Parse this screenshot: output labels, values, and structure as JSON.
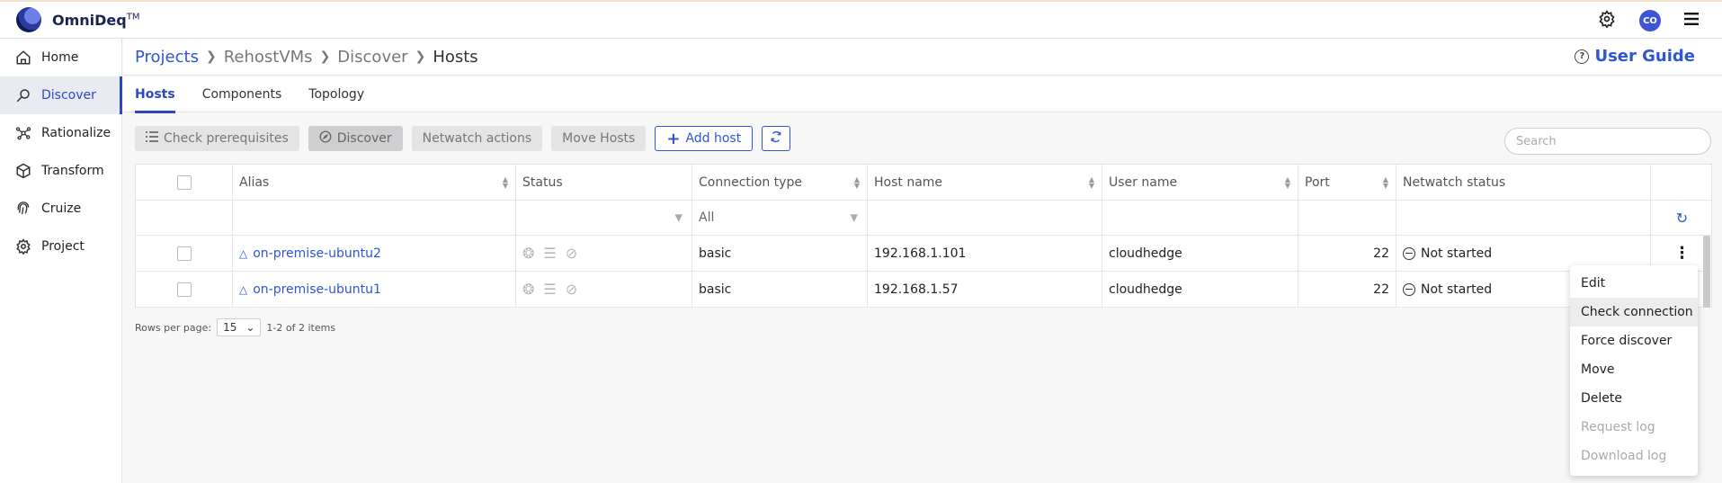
{
  "app": {
    "name": "OmniDeq",
    "tm": "TM",
    "avatar_initials": "CO"
  },
  "sidebar": {
    "items": [
      {
        "label": "Home",
        "icon": "home-icon",
        "active": false
      },
      {
        "label": "Discover",
        "icon": "discover-icon",
        "active": true
      },
      {
        "label": "Rationalize",
        "icon": "rationalize-icon",
        "active": false
      },
      {
        "label": "Transform",
        "icon": "cube-icon",
        "active": false
      },
      {
        "label": "Cruize",
        "icon": "fingerprint-icon",
        "active": false
      },
      {
        "label": "Project",
        "icon": "gear-icon",
        "active": false
      }
    ]
  },
  "breadcrumb": [
    "Projects",
    "RehostVMs",
    "Discover",
    "Hosts"
  ],
  "user_guide": {
    "label": "User Guide",
    "icon": "question-icon"
  },
  "tabs": [
    "Hosts",
    "Components",
    "Topology"
  ],
  "toolbar": {
    "check_prereq": "Check prerequisites",
    "discover": "Discover",
    "netwatch": "Netwatch actions",
    "move_hosts": "Move Hosts",
    "add_host": "Add host"
  },
  "search": {
    "placeholder": "Search"
  },
  "table": {
    "columns": [
      "Alias",
      "Status",
      "Connection type",
      "Host name",
      "User name",
      "Port",
      "Netwatch status"
    ],
    "filters": {
      "connection_type": "All"
    },
    "rows": [
      {
        "alias": "on-premise-ubuntu2",
        "connection_type": "basic",
        "host_name": "192.168.1.101",
        "user_name": "cloudhedge",
        "port": "22",
        "netwatch_status": "Not started"
      },
      {
        "alias": "on-premise-ubuntu1",
        "connection_type": "basic",
        "host_name": "192.168.1.57",
        "user_name": "cloudhedge",
        "port": "22",
        "netwatch_status": "Not started"
      }
    ]
  },
  "pager": {
    "rows_per_page_label": "Rows per page:",
    "rows_per_page": "15",
    "summary": "1-2 of 2 items"
  },
  "context_menu": {
    "items": [
      {
        "label": "Edit",
        "state": "normal"
      },
      {
        "label": "Check connection",
        "state": "hover"
      },
      {
        "label": "Force discover",
        "state": "normal"
      },
      {
        "label": "Move",
        "state": "normal"
      },
      {
        "label": "Delete",
        "state": "normal"
      },
      {
        "label": "Request log",
        "state": "disabled"
      },
      {
        "label": "Download log",
        "state": "disabled"
      }
    ]
  }
}
